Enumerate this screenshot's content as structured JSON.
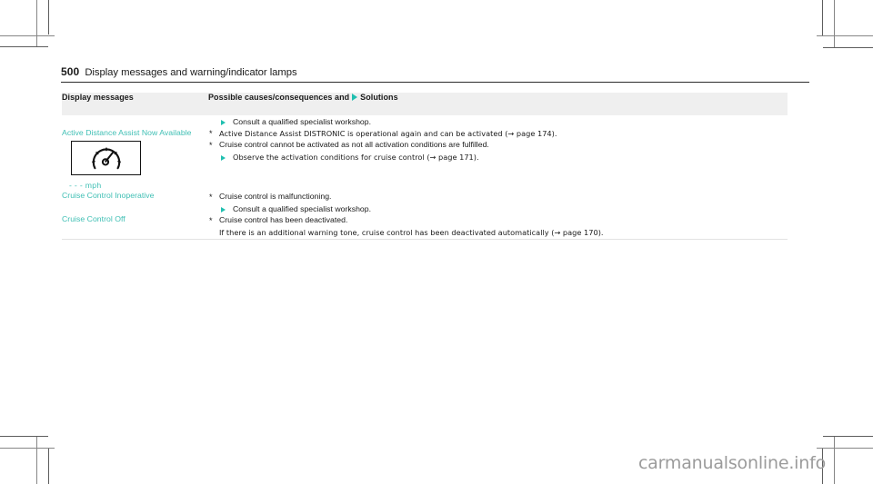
{
  "page": {
    "number": "500",
    "running_title": "Display messages and warning/indicator lamps",
    "watermark": "carmanualsonline.info"
  },
  "colors": {
    "accent_teal": "#3fbfb4",
    "bullet_teal": "#20bfb0",
    "header_background": "#efefef",
    "rule": "#2b2b2b",
    "border": "#e2e2e2"
  },
  "table": {
    "headers": {
      "col_display_messages": "Display messages",
      "col_causes_prefix": "Possible causes/consequences and",
      "col_causes_suffix": "Solutions",
      "bullet_icon": "triangle-right-icon"
    },
    "rows": [
      {
        "message": "",
        "symbol": null,
        "lines": [
          {
            "kind": "solution",
            "text": "Consult a qualified specialist workshop."
          }
        ]
      },
      {
        "message": "Active Distance Assist Now Available",
        "symbol": null,
        "lines": [
          {
            "kind": "cause",
            "marker": "*",
            "text": "Active Distance Assist DISTRONIC is operational again and can be activated (→ page 174)."
          }
        ]
      },
      {
        "message": "",
        "symbol": {
          "icon": "speedometer-icon",
          "caption": "- - - mph"
        },
        "lines": [
          {
            "kind": "cause",
            "marker": "*",
            "text": "Cruise control cannot be activated as not all activation conditions are fulfilled."
          },
          {
            "kind": "solution",
            "text": "Observe the activation conditions for cruise control (→ page 171)."
          }
        ]
      },
      {
        "message": "Cruise Control Inoperative",
        "symbol": null,
        "lines": [
          {
            "kind": "cause",
            "marker": "*",
            "text": "Cruise control is malfunctioning."
          },
          {
            "kind": "solution",
            "text": "Consult a qualified specialist workshop."
          }
        ]
      },
      {
        "message": "Cruise Control Off",
        "symbol": null,
        "lines": [
          {
            "kind": "cause",
            "marker": "*",
            "text": "Cruise control has been deactivated."
          },
          {
            "kind": "cont",
            "text": "If there is an additional warning tone, cruise control has been deactivated automatically (→ page 170)."
          }
        ]
      }
    ]
  }
}
